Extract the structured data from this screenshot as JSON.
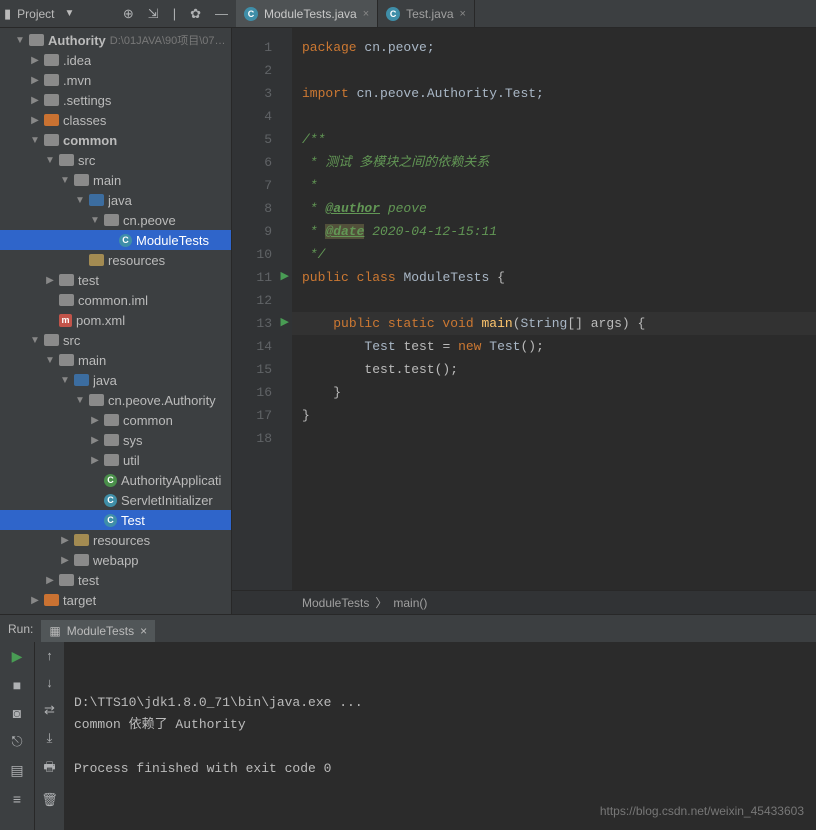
{
  "header": {
    "projectLabel": "Project",
    "tabs": [
      {
        "label": "ModuleTests.java",
        "active": true
      },
      {
        "label": "Test.java",
        "active": false
      }
    ]
  },
  "tree": {
    "root": {
      "name": "Authority",
      "path": "D:\\01JAVA\\90项目\\07…"
    },
    "items": [
      {
        "pad": "p1",
        "name": ".idea",
        "arrow": "closed",
        "iconClass": "ficon fd"
      },
      {
        "pad": "p1",
        "name": ".mvn",
        "arrow": "closed",
        "iconClass": "ficon fd"
      },
      {
        "pad": "p1",
        "name": ".settings",
        "arrow": "closed",
        "iconClass": "ficon fd"
      },
      {
        "pad": "p1",
        "name": "classes",
        "arrow": "closed",
        "iconClass": "ficon fd orange"
      },
      {
        "pad": "p1",
        "name": "common",
        "arrow": "open",
        "bold": true,
        "iconClass": "ficon fd"
      },
      {
        "pad": "p2",
        "name": "src",
        "arrow": "open",
        "iconClass": "ficon fd"
      },
      {
        "pad": "p3",
        "name": "main",
        "arrow": "open",
        "iconClass": "ficon fd"
      },
      {
        "pad": "p4",
        "name": "java",
        "arrow": "open",
        "iconClass": "ficon fd src"
      },
      {
        "pad": "p5",
        "name": "cn.peove",
        "arrow": "open",
        "iconClass": "ficon fd"
      },
      {
        "pad": "p6",
        "name": "ModuleTests",
        "selected": true,
        "iconClass": "cicon2",
        "iconTxt": "C"
      },
      {
        "pad": "p4",
        "name": "resources",
        "iconClass": "ficon fd res"
      },
      {
        "pad": "p2",
        "name": "test",
        "arrow": "closed",
        "iconClass": "ficon fd"
      },
      {
        "pad": "p2",
        "name": "common.iml",
        "iconClass": "ficon fd",
        "fileicon": true
      },
      {
        "pad": "p2",
        "name": "pom.xml",
        "iconClass": "micon",
        "iconTxt": "m"
      },
      {
        "pad": "p1",
        "name": "src",
        "arrow": "open",
        "iconClass": "ficon fd"
      },
      {
        "pad": "p2",
        "name": "main",
        "arrow": "open",
        "iconClass": "ficon fd"
      },
      {
        "pad": "p3",
        "name": "java",
        "arrow": "open",
        "iconClass": "ficon fd src"
      },
      {
        "pad": "p4",
        "name": "cn.peove.Authority",
        "arrow": "open",
        "iconClass": "ficon fd"
      },
      {
        "pad": "p5",
        "name": "common",
        "arrow": "closed",
        "iconClass": "ficon fd"
      },
      {
        "pad": "p5",
        "name": "sys",
        "arrow": "closed",
        "iconClass": "ficon fd"
      },
      {
        "pad": "p5",
        "name": "util",
        "arrow": "closed",
        "iconClass": "ficon fd"
      },
      {
        "pad": "p5",
        "name": "AuthorityApplicati",
        "iconClass": "cicon2 green",
        "iconTxt": "C"
      },
      {
        "pad": "p5",
        "name": "ServletInitializer",
        "iconClass": "cicon2",
        "iconTxt": "C"
      },
      {
        "pad": "p5",
        "name": "Test",
        "selected": true,
        "iconClass": "cicon2",
        "iconTxt": "C"
      },
      {
        "pad": "p3",
        "name": "resources",
        "arrow": "closed",
        "iconClass": "ficon fd res"
      },
      {
        "pad": "p3",
        "name": "webapp",
        "arrow": "closed",
        "iconClass": "ficon fd"
      },
      {
        "pad": "p2",
        "name": "test",
        "arrow": "closed",
        "iconClass": "ficon fd"
      },
      {
        "pad": "p1",
        "name": "target",
        "arrow": "closed",
        "iconClass": "ficon fd orange"
      }
    ]
  },
  "code": {
    "lines": [
      {
        "n": 1,
        "html": "<span class='kw'>package</span> <span class='pkg'>cn.peove;</span>"
      },
      {
        "n": 2,
        "html": ""
      },
      {
        "n": 3,
        "html": "<span class='kw'>import</span> <span class='pkg'>cn.peove.Authority.Test;</span>"
      },
      {
        "n": 4,
        "html": ""
      },
      {
        "n": 5,
        "html": "<span class='com'>/**</span>"
      },
      {
        "n": 6,
        "html": "<span class='com'> * 测试 多模块之间的依赖关系</span>"
      },
      {
        "n": 7,
        "html": "<span class='com'> *</span>"
      },
      {
        "n": 8,
        "html": "<span class='com'> * <span class='comtag'>@author</span> peove</span>"
      },
      {
        "n": 9,
        "html": "<span class='com'> * <span class='comtag bgg'>@date</span> 2020-04-12-15:11</span>"
      },
      {
        "n": 10,
        "html": "<span class='com'> */</span>"
      },
      {
        "n": 11,
        "html": "<span class='kw'>public class</span> <span class='type'>ModuleTests</span> {",
        "run": true
      },
      {
        "n": 12,
        "html": ""
      },
      {
        "n": 13,
        "html": "    <span class='kw'>public static void</span> <span class='method'>main</span>(<span class='type'>String</span>[] args) {",
        "run": true,
        "hl": true
      },
      {
        "n": 14,
        "html": "        <span class='type'>Test</span> test = <span class='kw'>new</span> <span class='type'>Test</span>();"
      },
      {
        "n": 15,
        "html": "        test.test();"
      },
      {
        "n": 16,
        "html": "    }"
      },
      {
        "n": 17,
        "html": "}"
      },
      {
        "n": 18,
        "html": ""
      }
    ],
    "breadcrumb": [
      "ModuleTests",
      "main()"
    ]
  },
  "run": {
    "label": "Run:",
    "tabName": "ModuleTests",
    "output": [
      "D:\\TTS10\\jdk1.8.0_71\\bin\\java.exe ...",
      "common 依赖了 Authority",
      "",
      "Process finished with exit code 0"
    ],
    "watermark": "https://blog.csdn.net/weixin_45433603"
  }
}
